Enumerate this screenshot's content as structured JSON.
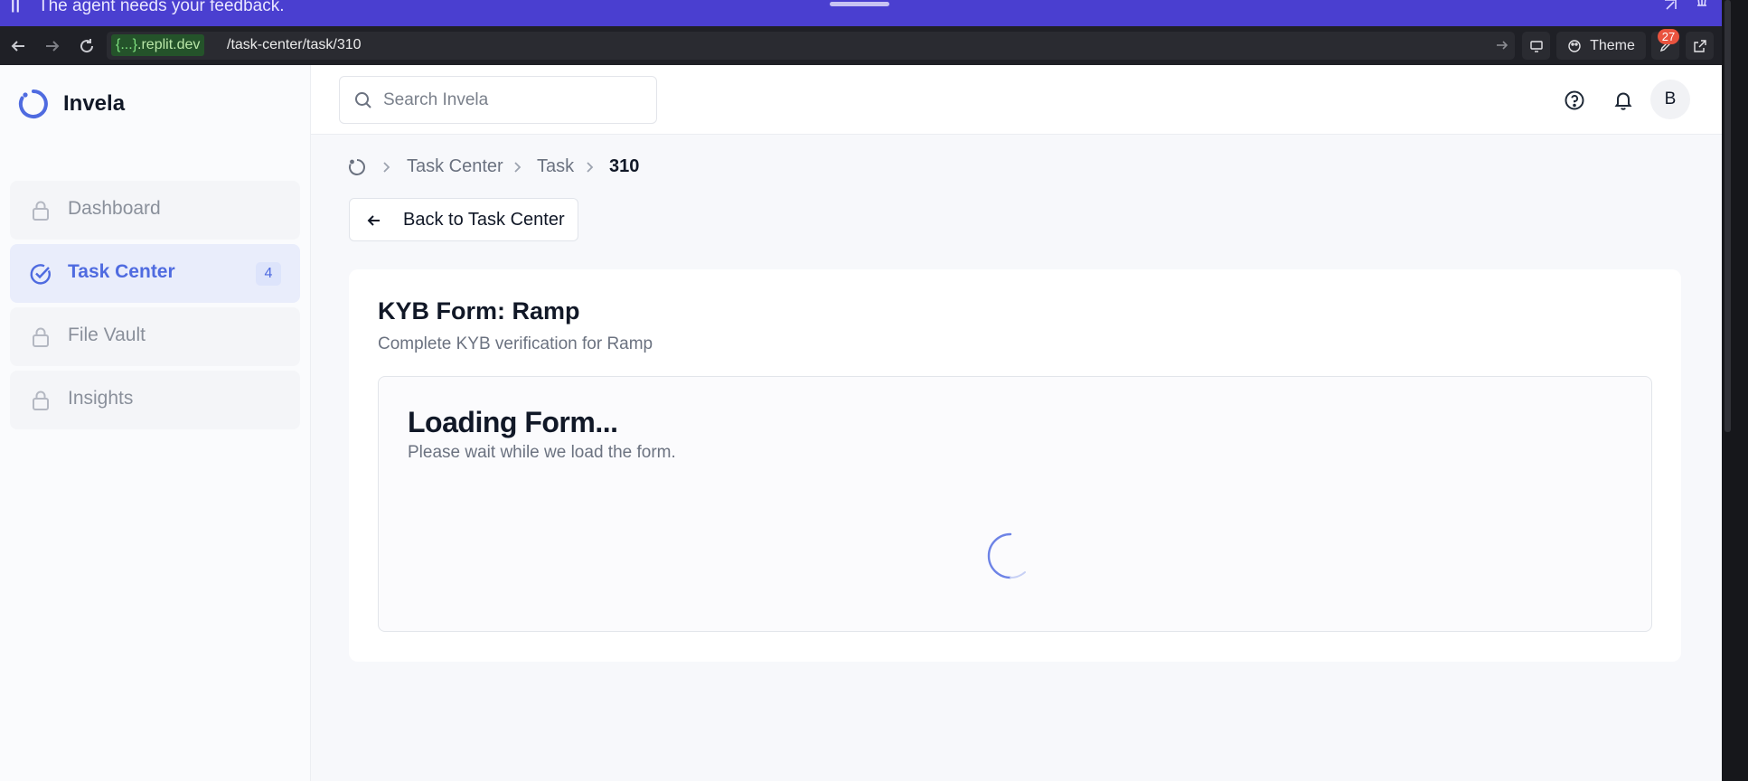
{
  "agent_bar": {
    "message": "The agent needs your feedback."
  },
  "browser": {
    "host_prefix": "{...}",
    "host_suffix": ".replit.dev",
    "path": "/task-center/task/310",
    "theme_label": "Theme",
    "notification_count": "27"
  },
  "sidebar": {
    "brand": "Invela",
    "items": [
      {
        "label": "Dashboard",
        "icon": "lock-icon",
        "locked": true
      },
      {
        "label": "Task Center",
        "icon": "check-circle-icon",
        "count": "4",
        "active": true
      },
      {
        "label": "File Vault",
        "icon": "lock-icon",
        "locked": true
      },
      {
        "label": "Insights",
        "icon": "lock-icon",
        "locked": true
      }
    ]
  },
  "topbar": {
    "search_placeholder": "Search Invela",
    "avatar_initial": "B"
  },
  "breadcrumb": [
    "Task Center",
    "Task",
    "310"
  ],
  "back_button": {
    "label": "Back to Task Center"
  },
  "form_card": {
    "title": "KYB Form: Ramp",
    "subtitle": "Complete KYB verification for Ramp",
    "loading_title": "Loading Form...",
    "loading_message": "Please wait while we load the form."
  },
  "colors": {
    "agent_bar": "#4a3fd0",
    "accent": "#4f6be0",
    "badge": "#e9533f"
  }
}
